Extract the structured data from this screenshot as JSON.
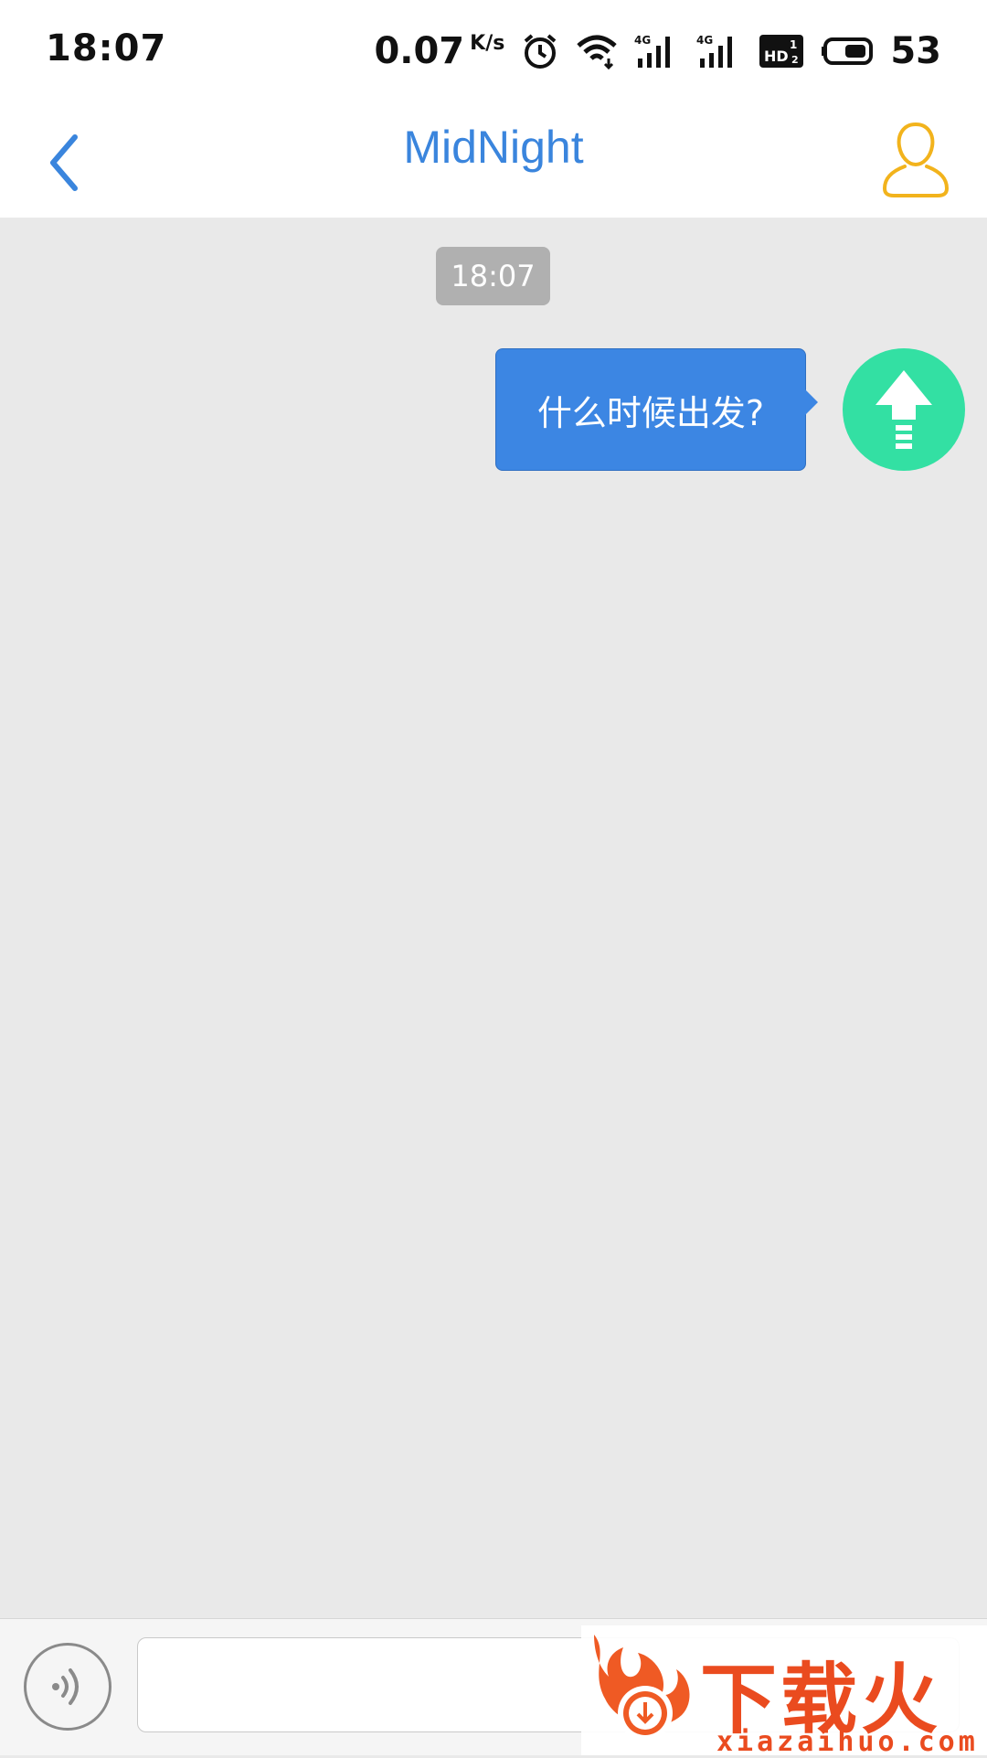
{
  "status_bar": {
    "time": "18:07",
    "net_speed": "0.07",
    "net_speed_unit": "K/s",
    "battery": "53",
    "icons": [
      "alarm-icon",
      "wifi-icon",
      "signal-4g-icon",
      "signal-4g-icon",
      "hd-icon",
      "battery-icon"
    ]
  },
  "header": {
    "title": "MidNight",
    "back_icon": "chevron-left-icon",
    "profile_icon": "user-outline-icon"
  },
  "chat": {
    "timestamp": "18:07",
    "messages": [
      {
        "text": "什么时候出发?",
        "avatar_icon": "upload-arrow-icon"
      }
    ]
  },
  "input_bar": {
    "voice_icon": "voice-icon",
    "input_value": "",
    "input_placeholder": ""
  },
  "watermark": {
    "text": "下载火",
    "url": "xiazaihuo.com"
  },
  "colors": {
    "accent": "#3a85dd",
    "bubble": "#3c86e3",
    "avatar": "#33e0a3",
    "profile_icon": "#f2b31c",
    "chat_bg": "#e9e9e9"
  }
}
